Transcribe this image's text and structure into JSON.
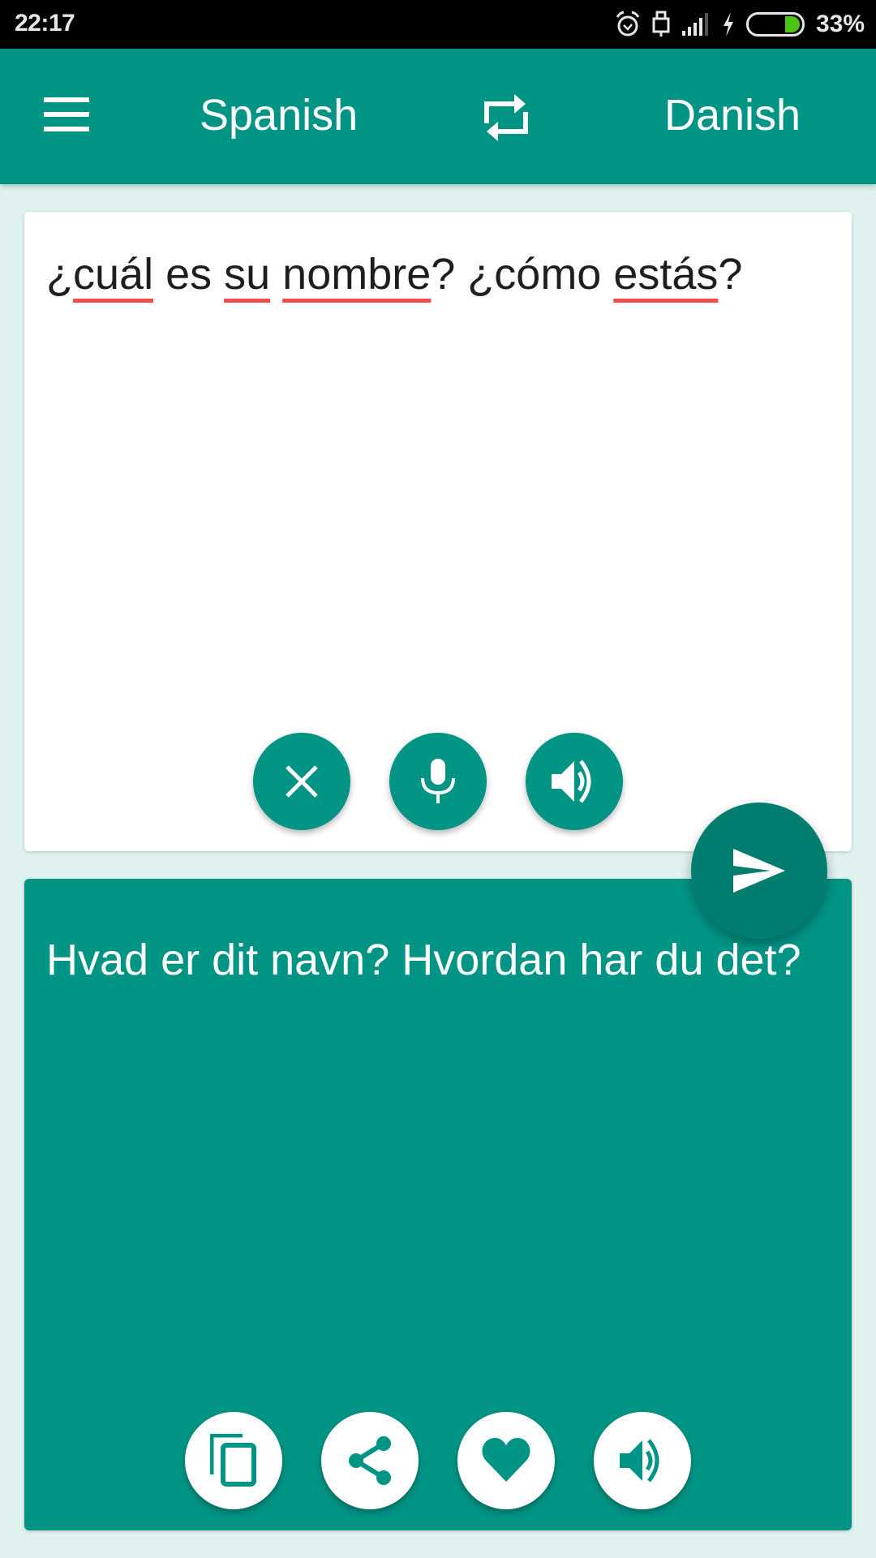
{
  "status_bar": {
    "time": "22:17",
    "icons": [
      "alarm-icon",
      "usb-icon",
      "signal-icon",
      "charging-icon",
      "battery-icon"
    ],
    "battery_percent": "33%",
    "battery_level": 0.33,
    "battery_color": "#4cc417"
  },
  "toolbar": {
    "menu_icon": "menu-icon",
    "source_language": "Spanish",
    "swap_icon": "swap-icon",
    "target_language": "Danish",
    "background_color": "#009485"
  },
  "input": {
    "segments": [
      {
        "text": "¿",
        "misspelled": false
      },
      {
        "text": "cuál",
        "misspelled": true
      },
      {
        "text": " es ",
        "misspelled": false
      },
      {
        "text": "su",
        "misspelled": true
      },
      {
        "text": " ",
        "misspelled": false
      },
      {
        "text": "nombre",
        "misspelled": true
      },
      {
        "text": "? ¿cómo ",
        "misspelled": false
      },
      {
        "text": "estás",
        "misspelled": true
      },
      {
        "text": "?",
        "misspelled": false
      }
    ],
    "full_text": "¿cuál es su nombre? ¿cómo estás?",
    "buttons": [
      {
        "name": "clear-button",
        "icon": "close-icon"
      },
      {
        "name": "microphone-button",
        "icon": "microphone-icon"
      },
      {
        "name": "speak-input-button",
        "icon": "speaker-icon"
      }
    ]
  },
  "translate_button": {
    "icon": "send-icon",
    "color": "#007d6f"
  },
  "output": {
    "text": "Hvad er dit navn? Hvordan har du det?",
    "buttons": [
      {
        "name": "copy-button",
        "icon": "copy-icon"
      },
      {
        "name": "share-button",
        "icon": "share-icon"
      },
      {
        "name": "favorite-button",
        "icon": "heart-icon"
      },
      {
        "name": "speak-output-button",
        "icon": "speaker-icon"
      }
    ]
  },
  "colors": {
    "accent": "#009485",
    "accent_dark": "#007d6f",
    "background": "#dff2ef",
    "spellcheck_underline": "#f44c4c"
  }
}
